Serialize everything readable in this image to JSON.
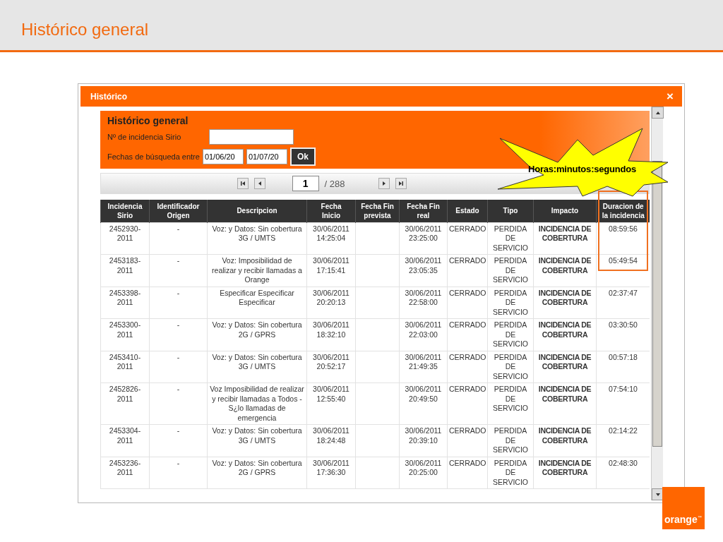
{
  "slide": {
    "title": "Histórico general"
  },
  "window": {
    "title": "Histórico",
    "close": "×"
  },
  "search": {
    "title": "Histórico general",
    "incident_label": "Nº de incidencia Sirio",
    "dates_label": "Fechas de búsqueda entre",
    "date_from": "01/06/20",
    "date_to": "01/07/20",
    "ok": "Ok"
  },
  "pager": {
    "page": "1",
    "total": "/ 288"
  },
  "table": {
    "columns": [
      "Incidencia Sirio",
      "Identificador Origen",
      "Descripcion",
      "Fecha Inicio",
      "Fecha Fin prevista",
      "Fecha Fin real",
      "Estado",
      "Tipo",
      "Impacto",
      "Duracion de la incidencia"
    ],
    "rows": [
      {
        "cells": [
          "2452930-2011",
          "-",
          "Voz: y Datos: Sin cobertura 3G / UMTS",
          "30/06/2011 14:25:04",
          "",
          "30/06/2011 23:25:00",
          "CERRADO",
          "PERDIDA DE SERVICIO",
          "INCIDENCIA DE COBERTURA",
          "08:59:56"
        ]
      },
      {
        "cells": [
          "2453183-2011",
          "-",
          "Voz: Imposibilidad de realizar y recibir llamadas a Orange",
          "30/06/2011 17:15:41",
          "",
          "30/06/2011 23:05:35",
          "CERRADO",
          "PERDIDA DE SERVICIO",
          "INCIDENCIA DE COBERTURA",
          "05:49:54"
        ]
      },
      {
        "cells": [
          "2453398-2011",
          "-",
          "Especificar Especificar Especificar",
          "30/06/2011 20:20:13",
          "",
          "30/06/2011 22:58:00",
          "CERRADO",
          "PERDIDA DE SERVICIO",
          "INCIDENCIA DE COBERTURA",
          "02:37:47"
        ]
      },
      {
        "cells": [
          "2453300-2011",
          "-",
          "Voz: y Datos: Sin cobertura 2G / GPRS",
          "30/06/2011 18:32:10",
          "",
          "30/06/2011 22:03:00",
          "CERRADO",
          "PERDIDA DE SERVICIO",
          "INCIDENCIA DE COBERTURA",
          "03:30:50"
        ]
      },
      {
        "cells": [
          "2453410-2011",
          "-",
          "Voz: y Datos: Sin cobertura 3G / UMTS",
          "30/06/2011 20:52:17",
          "",
          "30/06/2011 21:49:35",
          "CERRADO",
          "PERDIDA DE SERVICIO",
          "INCIDENCIA DE COBERTURA",
          "00:57:18"
        ]
      },
      {
        "cells": [
          "2452826-2011",
          "-",
          "Voz Imposibilidad de realizar y recibir llamadas a Todos - S¿lo llamadas de emergencia",
          "30/06/2011 12:55:40",
          "",
          "30/06/2011 20:49:50",
          "CERRADO",
          "PERDIDA DE SERVICIO",
          "INCIDENCIA DE COBERTURA",
          "07:54:10"
        ]
      },
      {
        "cells": [
          "2453304-2011",
          "-",
          "Voz: y Datos: Sin cobertura 3G / UMTS",
          "30/06/2011 18:24:48",
          "",
          "30/06/2011 20:39:10",
          "CERRADO",
          "PERDIDA DE SERVICIO",
          "INCIDENCIA DE COBERTURA",
          "02:14:22"
        ]
      },
      {
        "cells": [
          "2453236-2011",
          "-",
          "Voz: y Datos: Sin cobertura 2G / GPRS",
          "30/06/2011 17:36:30",
          "",
          "30/06/2011 20:25:00",
          "CERRADO",
          "PERDIDA DE SERVICIO",
          "INCIDENCIA DE COBERTURA",
          "02:48:30"
        ]
      }
    ]
  },
  "callout": {
    "text": "Horas:minutos:segundos"
  },
  "logo": {
    "text": "orange",
    "mark": "™"
  }
}
